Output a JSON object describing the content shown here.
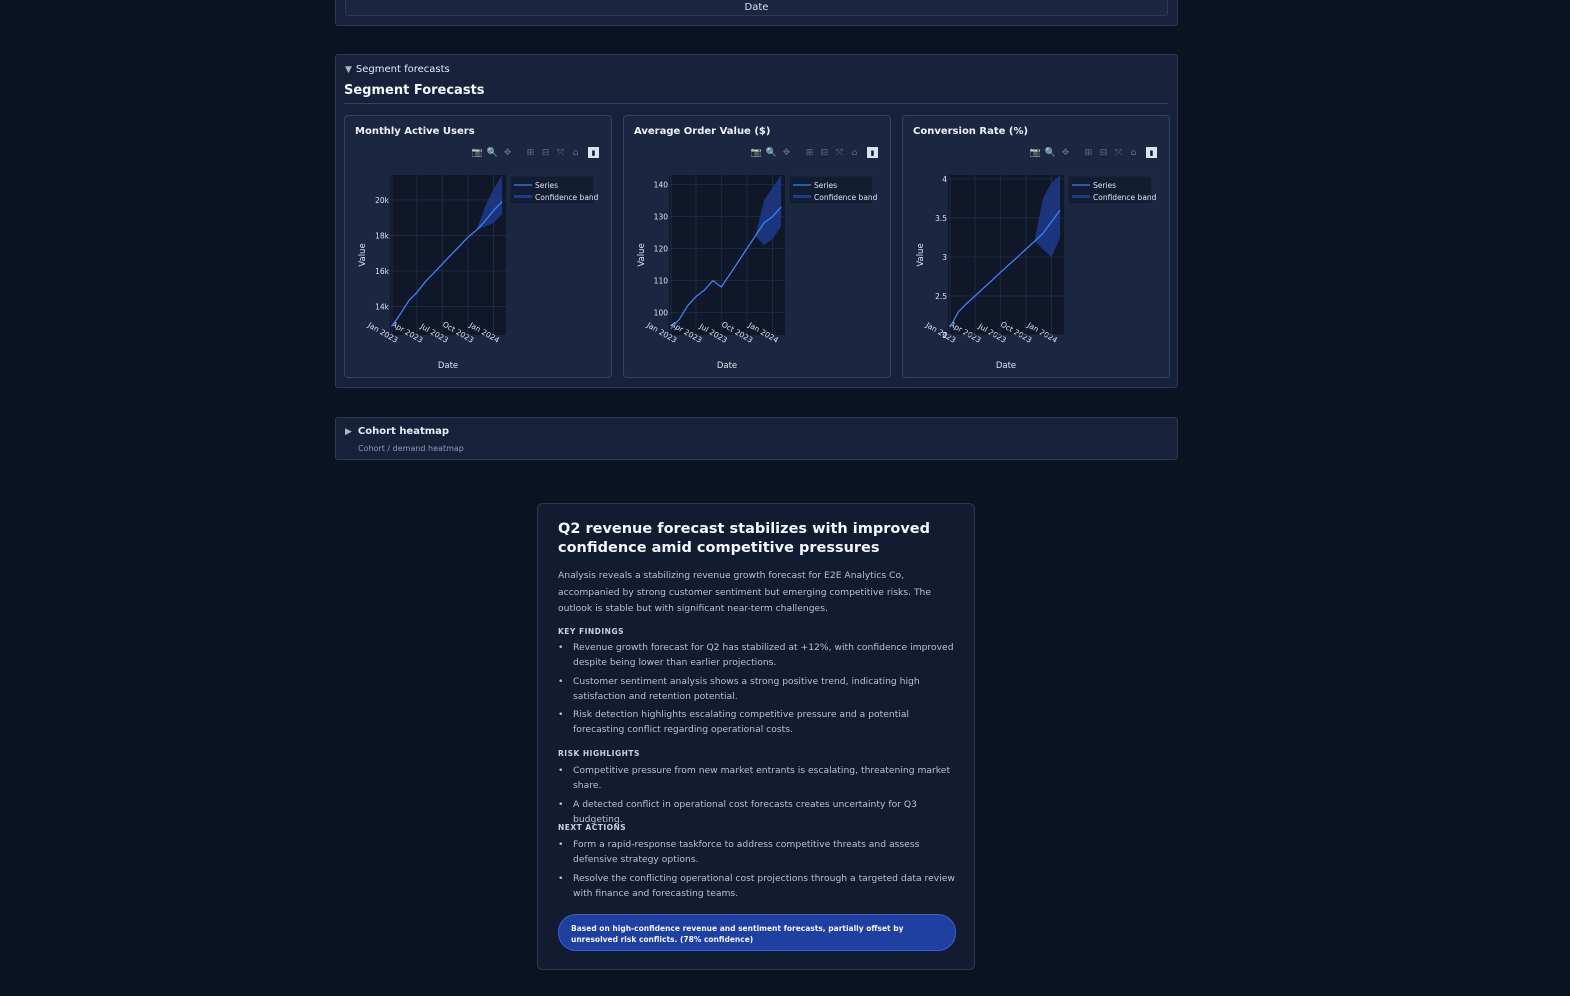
{
  "top_panel": {
    "x_axis_title": "Date"
  },
  "segment_section": {
    "summary_label": "Segment forecasts",
    "heading": "Segment Forecasts",
    "modebar_icons": [
      "camera-icon",
      "zoom-icon",
      "pan-icon",
      "zoom-in-icon",
      "zoom-out-icon",
      "autoscale-icon",
      "reset-axes-icon",
      "plotly-logo-icon"
    ]
  },
  "chart_data": [
    {
      "type": "line",
      "title": "Monthly Active Users",
      "xlabel": "Date",
      "ylabel": "Value",
      "x_ticks": [
        "Jan 2023",
        "Apr 2023",
        "Jul 2023",
        "Oct 2023",
        "Jan 2024"
      ],
      "y_ticks": [
        {
          "v": 14000,
          "label": "14k"
        },
        {
          "v": 16000,
          "label": "16k"
        },
        {
          "v": 18000,
          "label": "18k"
        },
        {
          "v": 20000,
          "label": "20k"
        }
      ],
      "xlim": [
        "2022-12-25",
        "2024-02-15"
      ],
      "ylim": [
        12400,
        21400
      ],
      "legend": [
        "Series",
        "Confidence band"
      ],
      "legend_position": "top-right",
      "series": [
        {
          "name": "Series",
          "x": [
            "2023-01-01",
            "2023-02-01",
            "2023-03-01",
            "2023-04-01",
            "2023-05-01",
            "2023-06-01",
            "2023-07-01",
            "2023-08-01",
            "2023-09-01",
            "2023-10-01",
            "2023-11-01",
            "2023-12-01",
            "2024-01-01",
            "2024-02-01"
          ],
          "values": [
            12900,
            13600,
            14300,
            14800,
            15400,
            15900,
            16400,
            16900,
            17400,
            17900,
            18300,
            18800,
            19400,
            19900
          ]
        }
      ],
      "band": {
        "x": [
          "2023-11-01",
          "2023-12-01",
          "2024-01-01",
          "2024-02-01"
        ],
        "lower": [
          18300,
          18500,
          18700,
          19200
        ],
        "upper": [
          18300,
          19600,
          20600,
          21400
        ]
      }
    },
    {
      "type": "line",
      "title": "Average Order Value ($)",
      "xlabel": "Date",
      "ylabel": "Value",
      "x_ticks": [
        "Jan 2023",
        "Apr 2023",
        "Jul 2023",
        "Oct 2023",
        "Jan 2024"
      ],
      "y_ticks": [
        {
          "v": 100,
          "label": "100"
        },
        {
          "v": 110,
          "label": "110"
        },
        {
          "v": 120,
          "label": "120"
        },
        {
          "v": 130,
          "label": "130"
        },
        {
          "v": 140,
          "label": "140"
        }
      ],
      "xlim": [
        "2022-12-25",
        "2024-02-15"
      ],
      "ylim": [
        93,
        143
      ],
      "legend": [
        "Series",
        "Confidence band"
      ],
      "legend_position": "top-right",
      "series": [
        {
          "name": "Series",
          "x": [
            "2023-01-01",
            "2023-02-01",
            "2023-03-01",
            "2023-04-01",
            "2023-05-01",
            "2023-06-01",
            "2023-07-01",
            "2023-08-01",
            "2023-09-01",
            "2023-10-01",
            "2023-11-01",
            "2023-12-01",
            "2024-01-01",
            "2024-02-01"
          ],
          "values": [
            95,
            98,
            102,
            105,
            107,
            110,
            108,
            112,
            116,
            120,
            124,
            128,
            130,
            133
          ]
        }
      ],
      "band": {
        "x": [
          "2023-11-01",
          "2023-12-01",
          "2024-01-01",
          "2024-02-01"
        ],
        "lower": [
          124,
          121,
          123,
          127
        ],
        "upper": [
          124,
          135,
          139,
          143
        ]
      }
    },
    {
      "type": "line",
      "title": "Conversion Rate (%)",
      "xlabel": "Date",
      "ylabel": "Value",
      "x_ticks": [
        "Jan 2023",
        "Apr 2023",
        "Jul 2023",
        "Oct 2023",
        "Jan 2024"
      ],
      "y_ticks": [
        {
          "v": 2,
          "label": "2"
        },
        {
          "v": 2.5,
          "label": "2.5"
        },
        {
          "v": 3,
          "label": "3"
        },
        {
          "v": 3.5,
          "label": "3.5"
        },
        {
          "v": 4,
          "label": "4"
        }
      ],
      "xlim": [
        "2022-12-25",
        "2024-02-15"
      ],
      "ylim": [
        2.0,
        4.05
      ],
      "legend": [
        "Series",
        "Confidence band"
      ],
      "legend_position": "top-right",
      "series": [
        {
          "name": "Series",
          "x": [
            "2023-01-01",
            "2023-02-01",
            "2023-03-01",
            "2023-04-01",
            "2023-05-01",
            "2023-06-01",
            "2023-07-01",
            "2023-08-01",
            "2023-09-01",
            "2023-10-01",
            "2023-11-01",
            "2023-12-01",
            "2024-01-01",
            "2024-02-01"
          ],
          "values": [
            2.1,
            2.3,
            2.4,
            2.5,
            2.6,
            2.7,
            2.8,
            2.9,
            3.0,
            3.1,
            3.2,
            3.3,
            3.45,
            3.6
          ]
        }
      ],
      "band": {
        "x": [
          "2023-11-01",
          "2023-12-01",
          "2024-01-01",
          "2024-02-01"
        ],
        "lower": [
          3.2,
          3.1,
          3.0,
          3.25
        ],
        "upper": [
          3.2,
          3.75,
          3.95,
          4.05
        ]
      }
    }
  ],
  "cohort_section": {
    "title": "Cohort heatmap",
    "subtitle": "Cohort / demand heatmap"
  },
  "summary": {
    "title": "Q2 revenue forecast stabilizes with improved confidence amid competitive pressures",
    "intro": "Analysis reveals a stabilizing revenue growth forecast for E2E Analytics Co, accompanied by strong customer sentiment but emerging competitive risks. The outlook is stable but with significant near-term challenges.",
    "key_findings_label": "KEY FINDINGS",
    "key_findings": [
      "Revenue growth forecast for Q2 has stabilized at +12%, with confidence improved despite being lower than earlier projections.",
      "Customer sentiment analysis shows a strong positive trend, indicating high satisfaction and retention potential.",
      "Risk detection highlights escalating competitive pressure and a potential forecasting conflict regarding operational costs."
    ],
    "risk_label": "RISK HIGHLIGHTS",
    "risks": [
      "Competitive pressure from new market entrants is escalating, threatening market share.",
      "A detected conflict in operational cost forecasts creates uncertainty for Q3 budgeting."
    ],
    "actions_label": "NEXT ACTIONS",
    "actions": [
      "Form a rapid-response taskforce to address competitive threats and assess defensive strategy options.",
      "Resolve the conflicting operational cost projections through a targeted data review with finance and forecasting teams."
    ],
    "confidence_note": "Based on high-confidence revenue and sentiment forecasts, partially offset by unresolved risk conflicts. (78% confidence)"
  },
  "colors": {
    "line": "#3b82f6",
    "band": "#1e3a8a",
    "plot_bg": "#0f1729",
    "grid": "#1f2b43",
    "text": "#dbe3ef",
    "pill": "#1f3fa1"
  }
}
